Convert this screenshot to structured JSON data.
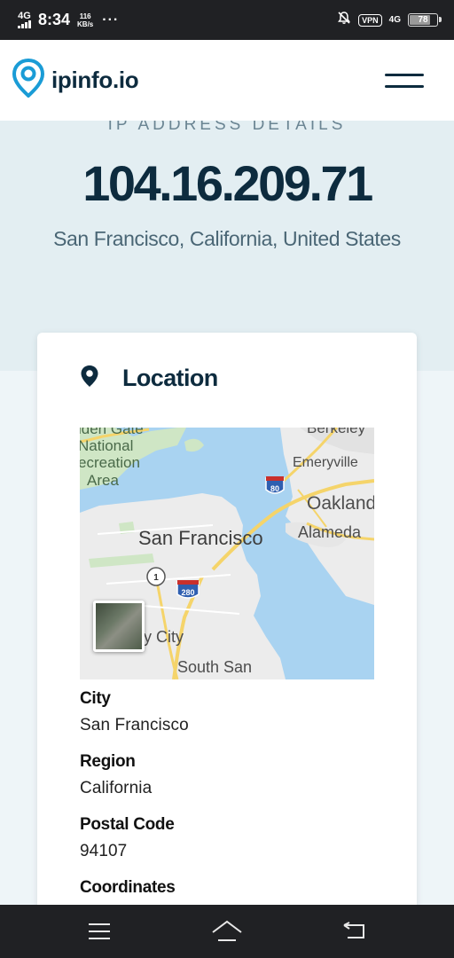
{
  "status_bar": {
    "network": "4G",
    "time": "8:34",
    "speed_value": "116",
    "speed_unit": "KB/s",
    "overflow": "···",
    "vpn": "VPN",
    "network_right": "4G",
    "battery": "78",
    "battery_level": 0.78
  },
  "header": {
    "logo_text": "ipinfo.io",
    "brand_color": "#1a9cd6",
    "text_color": "#0d2b3e"
  },
  "hero": {
    "eyebrow": "IP ADDRESS DETAILS",
    "ip": "104.16.209.71",
    "location": "San Francisco, California, United States"
  },
  "location_card": {
    "title": "Location",
    "map": {
      "labels": {
        "golden_gate": "lden Gate",
        "national": "National",
        "recreation": "ecreation",
        "area": "Area",
        "berkeley": "Berkeley",
        "emeryville": "Emeryville",
        "oakland": "Oakland",
        "alameda": "Alameda",
        "san_francisco": "San Francisco",
        "daly_city": "ly City",
        "south_san": "South San",
        "route_1": "1",
        "route_280": "280",
        "route_80": "80"
      }
    },
    "fields": [
      {
        "label": "City",
        "value": "San Francisco"
      },
      {
        "label": "Region",
        "value": "California"
      },
      {
        "label": "Postal Code",
        "value": "94107"
      },
      {
        "label": "Coordinates",
        "value": ""
      }
    ]
  }
}
